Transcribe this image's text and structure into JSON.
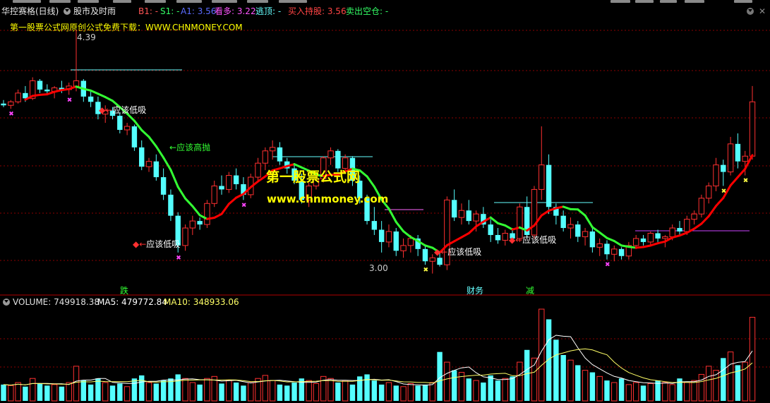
{
  "header": {
    "stock_name": "华控赛格",
    "period": "(日线)",
    "indicator_name": "股市及时雨",
    "b1": "B1: -",
    "s1": "S1: -",
    "a1": "A1: 3.56",
    "kanduo": "看多: 3.22",
    "taoding": "逃顶: -",
    "buy_hold": "买入持股: 3.56",
    "sell_empty": "卖出空仓: -"
  },
  "promo_text": "第一股票公式网原创公式免费下载：WWW.CHNMONEY.COM",
  "watermark": {
    "line1": "第一股票公式网",
    "line2": "www.chnmoney.com"
  },
  "annotations": {
    "high_price": "4.39",
    "low_price": "3.00",
    "buy_low_1": "应该低吸",
    "buy_low_2": "应该低吸",
    "buy_low_3": "应该低吸",
    "buy_low_4": "应该低吸",
    "sell_high": "应该高抛",
    "event_1": "跌",
    "event_2": "财务",
    "event_3": "减"
  },
  "volume_header": {
    "volume": "VOLUME: 749918.38",
    "ma5": "MA5: 479772.84",
    "ma10": "MA10: 348933.06"
  },
  "colors": {
    "up": "#ff3030",
    "down": "#54ffff",
    "ma_down": "#33ff33",
    "ma_up": "#ff0000",
    "grid": "#8b0000",
    "ma5": "#ffffff",
    "ma10": "#ffff66",
    "purple_mark": "#ff44ff"
  },
  "chart_data": {
    "type": "candlestick",
    "price_ohlc": [
      [
        3.97,
        3.99,
        3.95,
        3.96
      ],
      [
        3.96,
        3.99,
        3.94,
        3.98
      ],
      [
        3.98,
        4.05,
        3.97,
        4.03
      ],
      [
        4.03,
        4.07,
        3.98,
        4.0
      ],
      [
        4.0,
        4.12,
        3.99,
        4.1
      ],
      [
        4.1,
        4.11,
        4.03,
        4.05
      ],
      [
        4.05,
        4.08,
        4.02,
        4.04
      ],
      [
        4.04,
        4.07,
        4.0,
        4.06
      ],
      [
        4.06,
        4.1,
        4.03,
        4.05
      ],
      [
        4.05,
        4.09,
        4.02,
        4.07
      ],
      [
        4.07,
        4.39,
        4.04,
        4.1
      ],
      [
        4.1,
        4.11,
        3.98,
        4.01
      ],
      [
        4.01,
        4.04,
        3.95,
        3.98
      ],
      [
        3.98,
        4.01,
        3.88,
        3.91
      ],
      [
        3.91,
        3.96,
        3.86,
        3.93
      ],
      [
        3.93,
        3.95,
        3.88,
        3.9
      ],
      [
        3.9,
        3.92,
        3.8,
        3.82
      ],
      [
        3.82,
        3.86,
        3.79,
        3.84
      ],
      [
        3.84,
        3.85,
        3.7,
        3.72
      ],
      [
        3.72,
        3.76,
        3.59,
        3.61
      ],
      [
        3.61,
        3.66,
        3.58,
        3.64
      ],
      [
        3.64,
        3.68,
        3.53,
        3.55
      ],
      [
        3.55,
        3.6,
        3.42,
        3.45
      ],
      [
        3.45,
        3.48,
        3.3,
        3.33
      ],
      [
        3.33,
        3.35,
        3.12,
        3.16
      ],
      [
        3.16,
        3.28,
        3.13,
        3.26
      ],
      [
        3.26,
        3.33,
        3.22,
        3.3
      ],
      [
        3.3,
        3.32,
        3.25,
        3.28
      ],
      [
        3.28,
        3.42,
        3.26,
        3.4
      ],
      [
        3.4,
        3.53,
        3.38,
        3.5
      ],
      [
        3.5,
        3.56,
        3.45,
        3.48
      ],
      [
        3.48,
        3.58,
        3.46,
        3.56
      ],
      [
        3.56,
        3.6,
        3.48,
        3.51
      ],
      [
        3.51,
        3.55,
        3.42,
        3.45
      ],
      [
        3.45,
        3.57,
        3.43,
        3.55
      ],
      [
        3.55,
        3.66,
        3.52,
        3.63
      ],
      [
        3.63,
        3.72,
        3.59,
        3.7
      ],
      [
        3.7,
        3.76,
        3.65,
        3.72
      ],
      [
        3.72,
        3.75,
        3.62,
        3.64
      ],
      [
        3.64,
        3.66,
        3.57,
        3.6
      ],
      [
        3.6,
        3.63,
        3.51,
        3.53
      ],
      [
        3.53,
        3.57,
        3.4,
        3.42
      ],
      [
        3.42,
        3.52,
        3.38,
        3.5
      ],
      [
        3.5,
        3.56,
        3.48,
        3.54
      ],
      [
        3.54,
        3.67,
        3.52,
        3.66
      ],
      [
        3.66,
        3.72,
        3.62,
        3.7
      ],
      [
        3.7,
        3.71,
        3.58,
        3.6
      ],
      [
        3.6,
        3.68,
        3.58,
        3.66
      ],
      [
        3.66,
        3.67,
        3.5,
        3.53
      ],
      [
        3.53,
        3.56,
        3.4,
        3.43
      ],
      [
        3.43,
        3.45,
        3.28,
        3.3
      ],
      [
        3.3,
        3.38,
        3.22,
        3.25
      ],
      [
        3.25,
        3.3,
        3.12,
        3.18
      ],
      [
        3.18,
        3.28,
        3.15,
        3.24
      ],
      [
        3.24,
        3.26,
        3.1,
        3.13
      ],
      [
        3.13,
        3.2,
        3.09,
        3.16
      ],
      [
        3.16,
        3.22,
        3.12,
        3.2
      ],
      [
        3.2,
        3.22,
        3.1,
        3.14
      ],
      [
        3.14,
        3.16,
        3.05,
        3.07
      ],
      [
        3.07,
        3.11,
        3.0,
        3.09
      ],
      [
        3.09,
        3.12,
        3.04,
        3.05
      ],
      [
        3.05,
        3.44,
        3.02,
        3.42
      ],
      [
        3.42,
        3.48,
        3.3,
        3.32
      ],
      [
        3.32,
        3.4,
        3.28,
        3.36
      ],
      [
        3.36,
        3.42,
        3.28,
        3.3
      ],
      [
        3.3,
        3.36,
        3.24,
        3.34
      ],
      [
        3.34,
        3.38,
        3.26,
        3.28
      ],
      [
        3.28,
        3.31,
        3.18,
        3.22
      ],
      [
        3.22,
        3.26,
        3.17,
        3.19
      ],
      [
        3.19,
        3.25,
        3.16,
        3.23
      ],
      [
        3.23,
        3.26,
        3.18,
        3.2
      ],
      [
        3.2,
        3.4,
        3.18,
        3.38
      ],
      [
        3.38,
        3.44,
        3.2,
        3.22
      ],
      [
        3.22,
        3.5,
        3.2,
        3.48
      ],
      [
        3.48,
        3.84,
        3.42,
        3.62
      ],
      [
        3.62,
        3.68,
        3.34,
        3.38
      ],
      [
        3.38,
        3.4,
        3.28,
        3.33
      ],
      [
        3.33,
        3.36,
        3.24,
        3.26
      ],
      [
        3.26,
        3.32,
        3.2,
        3.28
      ],
      [
        3.28,
        3.3,
        3.18,
        3.21
      ],
      [
        3.21,
        3.26,
        3.16,
        3.24
      ],
      [
        3.24,
        3.26,
        3.12,
        3.15
      ],
      [
        3.15,
        3.2,
        3.1,
        3.17
      ],
      [
        3.17,
        3.19,
        3.08,
        3.11
      ],
      [
        3.11,
        3.16,
        3.07,
        3.14
      ],
      [
        3.14,
        3.15,
        3.08,
        3.1
      ],
      [
        3.1,
        3.18,
        3.08,
        3.16
      ],
      [
        3.16,
        3.22,
        3.14,
        3.2
      ],
      [
        3.2,
        3.22,
        3.16,
        3.18
      ],
      [
        3.18,
        3.24,
        3.16,
        3.23
      ],
      [
        3.23,
        3.25,
        3.18,
        3.2
      ],
      [
        3.2,
        3.22,
        3.15,
        3.21
      ],
      [
        3.21,
        3.28,
        3.19,
        3.26
      ],
      [
        3.26,
        3.3,
        3.22,
        3.24
      ],
      [
        3.24,
        3.33,
        3.22,
        3.31
      ],
      [
        3.31,
        3.36,
        3.28,
        3.34
      ],
      [
        3.34,
        3.45,
        3.32,
        3.43
      ],
      [
        3.43,
        3.52,
        3.4,
        3.5
      ],
      [
        3.5,
        3.66,
        3.47,
        3.62
      ],
      [
        3.62,
        3.65,
        3.5,
        3.58
      ],
      [
        3.58,
        3.78,
        3.56,
        3.74
      ],
      [
        3.74,
        3.8,
        3.6,
        3.64
      ],
      [
        3.64,
        3.7,
        3.56,
        3.67
      ],
      [
        3.67,
        4.07,
        3.65,
        3.98
      ]
    ],
    "volume": [
      16,
      15,
      18,
      14,
      22,
      17,
      15,
      16,
      14,
      18,
      34,
      20,
      16,
      22,
      18,
      15,
      17,
      14,
      22,
      25,
      18,
      17,
      20,
      22,
      26,
      22,
      18,
      16,
      22,
      24,
      17,
      20,
      18,
      15,
      18,
      22,
      25,
      20,
      16,
      15,
      18,
      22,
      20,
      17,
      24,
      22,
      18,
      20,
      16,
      24,
      26,
      20,
      16,
      18,
      15,
      14,
      17,
      15,
      16,
      18,
      48,
      38,
      30,
      28,
      22,
      20,
      18,
      25,
      20,
      22,
      24,
      38,
      50,
      42,
      90,
      80,
      60,
      45,
      40,
      35,
      30,
      28,
      24,
      20,
      18,
      22,
      16,
      18,
      15,
      17,
      20,
      18,
      16,
      22,
      18,
      20,
      26,
      34,
      30,
      42,
      48,
      35,
      38,
      82
    ],
    "price_range": [
      2.95,
      4.4
    ],
    "ma5_ratio_note": "",
    "xlabel": "",
    "ylabel": ""
  }
}
